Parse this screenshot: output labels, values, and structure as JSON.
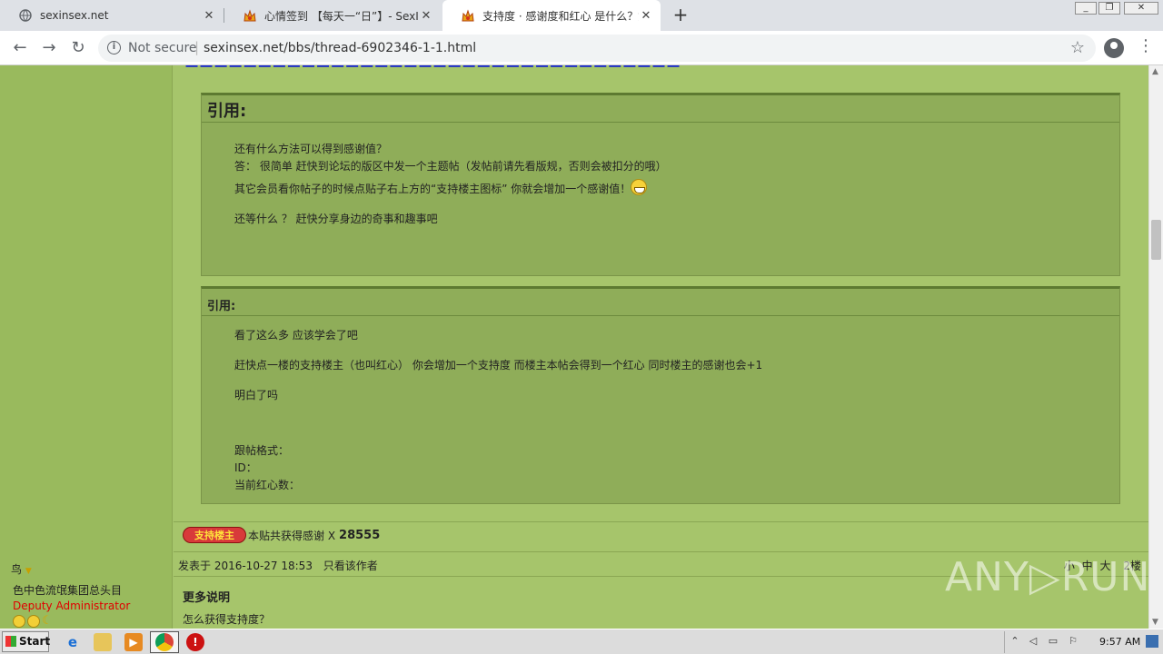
{
  "browser": {
    "tabs": [
      {
        "title": "sexinsex.net",
        "favicon": "globe-icon"
      },
      {
        "title": "心情签到 【每天一“日”】- SexInSex! ",
        "favicon": "site-logo-icon"
      },
      {
        "title": "支持度 · 感谢度和红心 是什么？如",
        "favicon": "site-logo-icon"
      }
    ],
    "new_tab": "+",
    "security_label": "Not secure",
    "url": "sexinsex.net/bbs/thread-6902346-1-1.html"
  },
  "post": {
    "quote1": {
      "header": "引用:",
      "lines": [
        "还有什么方法可以得到感谢值？",
        "答：  很简单  赶快到论坛的版区中发一个主题帖（发帖前请先看版规，否则会被扣分的哦）",
        "其它会员看你帖子的时候点贴子右上方的“支持楼主图标” 你就会增加一个感谢值！",
        "还等什么 ？    赶快分享身边的奇事和趣事吧"
      ]
    },
    "quote2": {
      "header": "引用:",
      "lines": [
        "看了这么多 应该学会了吧",
        "赶快点一楼的支持楼主（也叫红心）   你会增加一个支持度  而楼主本帖会得到一个红心  同时楼主的感谢也会+1",
        "明白了吗",
        "跟帖格式：",
        "ID：",
        "当前红心数："
      ]
    },
    "support_badge": "支持楼主",
    "thanks_text": "本贴共获得感谢 X",
    "thanks_count": "28555",
    "next_post": {
      "posted_at": "发表于 2016-10-27 18:53",
      "only_author": "只看该作者",
      "font_small": "小",
      "font_medium": "中",
      "font_large": "大",
      "floor": "2楼",
      "title": "更多说明",
      "first_line": "怎么获得支持度？"
    }
  },
  "author": {
    "name": "鸟",
    "group": "色中色流氓集团总头目",
    "rank": "Deputy Administrator",
    "rank_color": "#e00000"
  },
  "watermark": "ANY▷RUN",
  "taskbar": {
    "start_label": "Start",
    "clock": "9:57 AM"
  }
}
